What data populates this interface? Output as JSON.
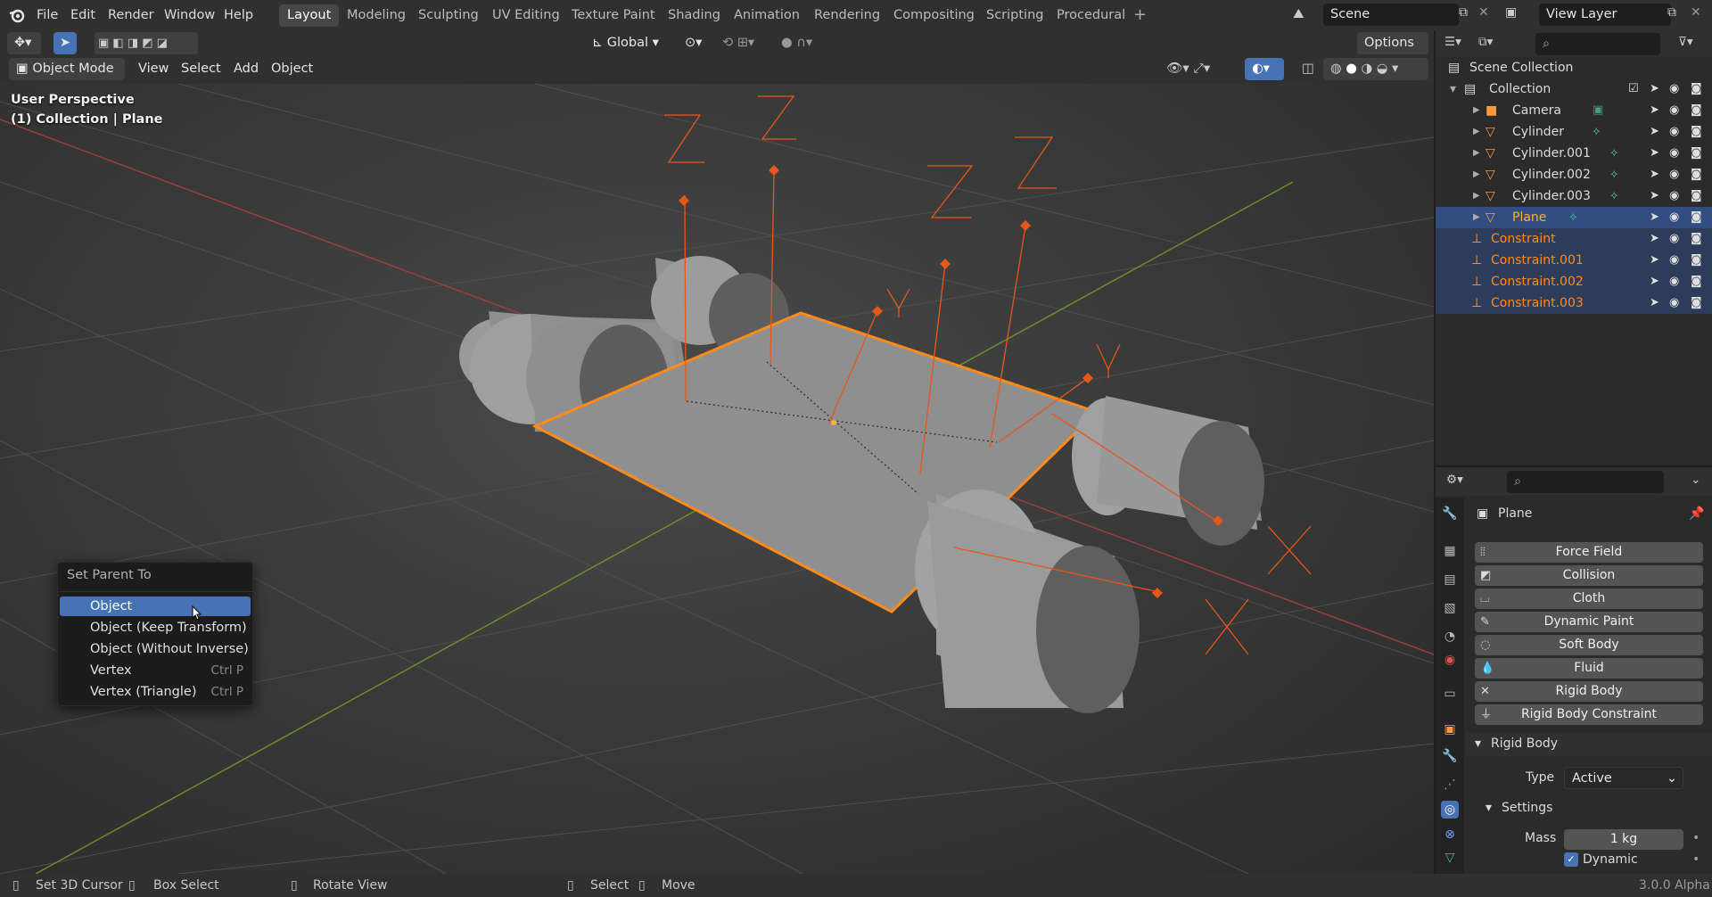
{
  "menubar": {
    "items": [
      "File",
      "Edit",
      "Render",
      "Window",
      "Help"
    ],
    "workspaces": [
      "Layout",
      "Modeling",
      "Sculpting",
      "UV Editing",
      "Texture Paint",
      "Shading",
      "Animation",
      "Rendering",
      "Compositing",
      "Scripting",
      "Procedural"
    ],
    "active_workspace": "Layout",
    "scene": "Scene",
    "view_layer": "View Layer"
  },
  "viewport_header": {
    "mode": "Object Mode",
    "menus": [
      "View",
      "Select",
      "Add",
      "Object"
    ],
    "transform_orientation": "Global",
    "options_label": "Options"
  },
  "viewport": {
    "perspective_label": "User Perspective",
    "collection_label": "(1) Collection | Plane"
  },
  "context_menu": {
    "title": "Set Parent To",
    "items": [
      {
        "label": "Object",
        "shortcut": "",
        "selected": true
      },
      {
        "label": "Object (Keep Transform)",
        "shortcut": ""
      },
      {
        "label": "Object (Without Inverse)",
        "shortcut": ""
      },
      {
        "label": "Vertex",
        "shortcut": "Ctrl P"
      },
      {
        "label": "Vertex (Triangle)",
        "shortcut": "Ctrl P"
      }
    ]
  },
  "outliner": {
    "root": "Scene Collection",
    "collection": "Collection",
    "items": [
      {
        "name": "Camera",
        "type": "camera"
      },
      {
        "name": "Cylinder",
        "type": "mesh"
      },
      {
        "name": "Cylinder.001",
        "type": "mesh"
      },
      {
        "name": "Cylinder.002",
        "type": "mesh"
      },
      {
        "name": "Cylinder.003",
        "type": "mesh"
      },
      {
        "name": "Plane",
        "type": "mesh",
        "active": true
      },
      {
        "name": "Constraint",
        "type": "empty"
      },
      {
        "name": "Constraint.001",
        "type": "empty"
      },
      {
        "name": "Constraint.002",
        "type": "empty"
      },
      {
        "name": "Constraint.003",
        "type": "empty"
      }
    ]
  },
  "properties": {
    "object_name": "Plane",
    "physics_buttons": [
      "Force Field",
      "Collision",
      "Cloth",
      "Dynamic Paint",
      "Soft Body",
      "Fluid",
      "Rigid Body",
      "Rigid Body Constraint"
    ],
    "rigid_body_panel": "Rigid Body",
    "type_label": "Type",
    "type_value": "Active",
    "settings_panel": "Settings",
    "mass_label": "Mass",
    "mass_value": "1 kg",
    "dynamic_label": "Dynamic"
  },
  "statusbar": {
    "items": [
      "Set 3D Cursor",
      "Box Select",
      "Rotate View",
      "Select",
      "Move"
    ],
    "version": "3.0.0 Alpha"
  },
  "colors": {
    "accent": "#4772b3",
    "selection_orange": "#ff8c1a",
    "empty_orange": "#e8561a",
    "outliner_selected": "#334d80"
  }
}
